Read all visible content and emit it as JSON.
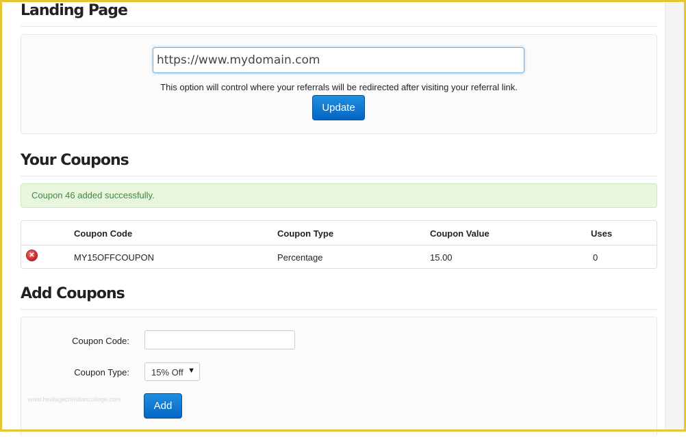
{
  "landing": {
    "title": "Landing Page",
    "url_value": "https://www.mydomain.com",
    "hint": "This option will control where your referrals will be redirected after visiting your referral link.",
    "update_label": "Update"
  },
  "coupons": {
    "title": "Your Coupons",
    "alert": "Coupon 46 added successfully.",
    "columns": [
      "Coupon Code",
      "Coupon Type",
      "Coupon Value",
      "Uses"
    ],
    "rows": [
      {
        "code": "MY15OFFCOUPON",
        "type": "Percentage",
        "value": "15.00",
        "uses": "0"
      }
    ]
  },
  "add": {
    "title": "Add Coupons",
    "code_label": "Coupon Code:",
    "type_label": "Coupon Type:",
    "type_selected": "15% Off",
    "add_label": "Add",
    "watermark": "www.heritagechristiancollege.com"
  },
  "colors": {
    "primary": "#0a6fd0",
    "success_bg": "#e8f6de",
    "success_text": "#3c8a3c",
    "frame": "#e6c630",
    "delete_icon": "#c8201d"
  },
  "icons": {
    "delete": "close-circle-icon",
    "dropdown": "caret-down-icon"
  }
}
